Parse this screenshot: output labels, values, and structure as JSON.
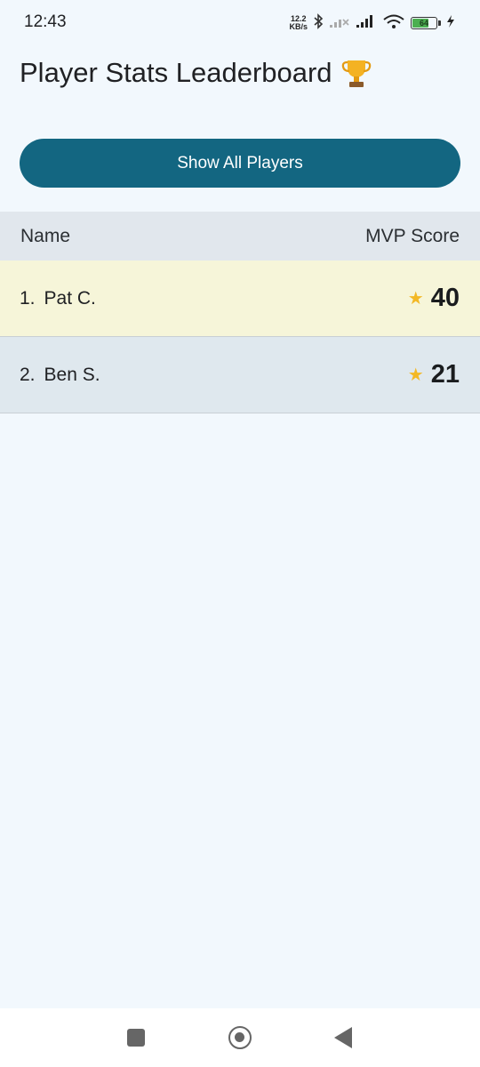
{
  "status_bar": {
    "time": "12:43",
    "net_speed_value": "12.2",
    "net_speed_unit": "KB/s",
    "battery_level": "64",
    "icons": [
      "bluetooth-icon",
      "signal-icon",
      "wifi-icon",
      "battery-icon",
      "charging-icon"
    ]
  },
  "header": {
    "title": "Player Stats Leaderboard",
    "title_icon": "trophy-icon"
  },
  "actions": {
    "show_all_label": "Show All Players"
  },
  "table": {
    "columns": [
      "Name",
      "MVP Score"
    ],
    "rows": [
      {
        "rank": "1.",
        "name": "Pat C.",
        "score": "40",
        "background": "#f6f5d9"
      },
      {
        "rank": "2.",
        "name": "Ben S.",
        "score": "21",
        "background": "#dfe8ee"
      }
    ]
  },
  "colors": {
    "accent": "#136681",
    "star": "#f3b825",
    "background": "#f2f8fd"
  },
  "nav_bar": {
    "icons": [
      "recents-icon",
      "home-icon",
      "back-icon"
    ]
  }
}
